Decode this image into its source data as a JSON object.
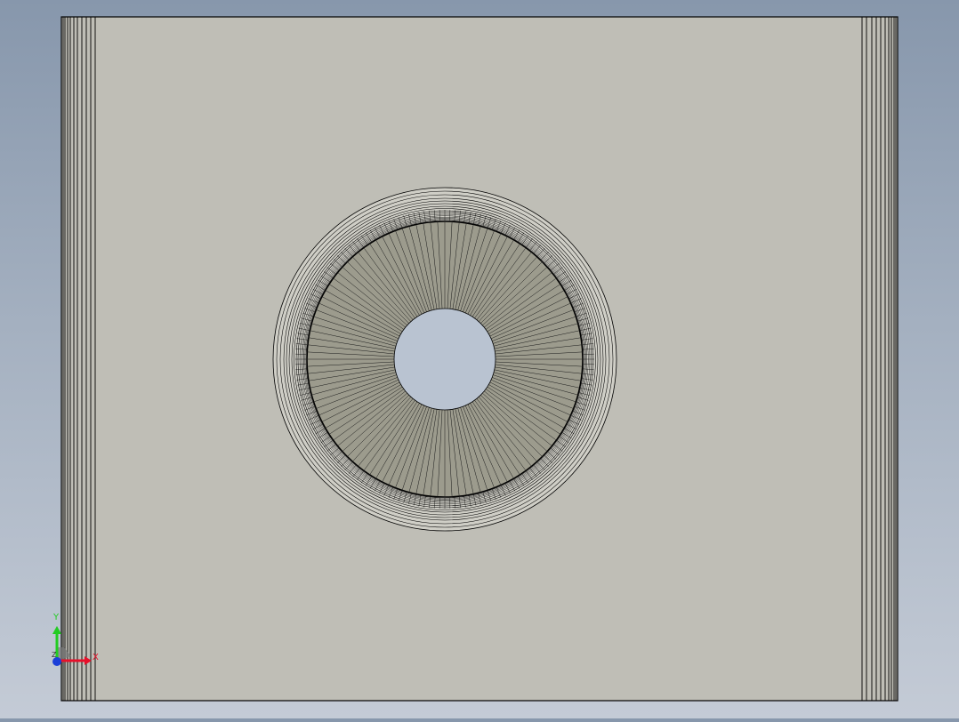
{
  "viewport": {
    "background_top": "#8797ac",
    "background_bottom": "#c4cbd6",
    "part_face_color": "#bfbeb6",
    "part_edge_color": "#000000",
    "hole_fill_color": "#b9c3d1",
    "cone_fill_color": "#9c9b8d",
    "fillet_fill_color": "#cfcec6"
  },
  "model": {
    "view": "front",
    "features": [
      "rectangular-plate",
      "countersunk-through-hole",
      "edge-chamfers"
    ]
  },
  "triad": {
    "x_label": "X",
    "y_label": "Y",
    "z_label": "Z",
    "x_color": "#e8102a",
    "y_color": "#22cc22",
    "z_color": "#1b3fd8"
  }
}
